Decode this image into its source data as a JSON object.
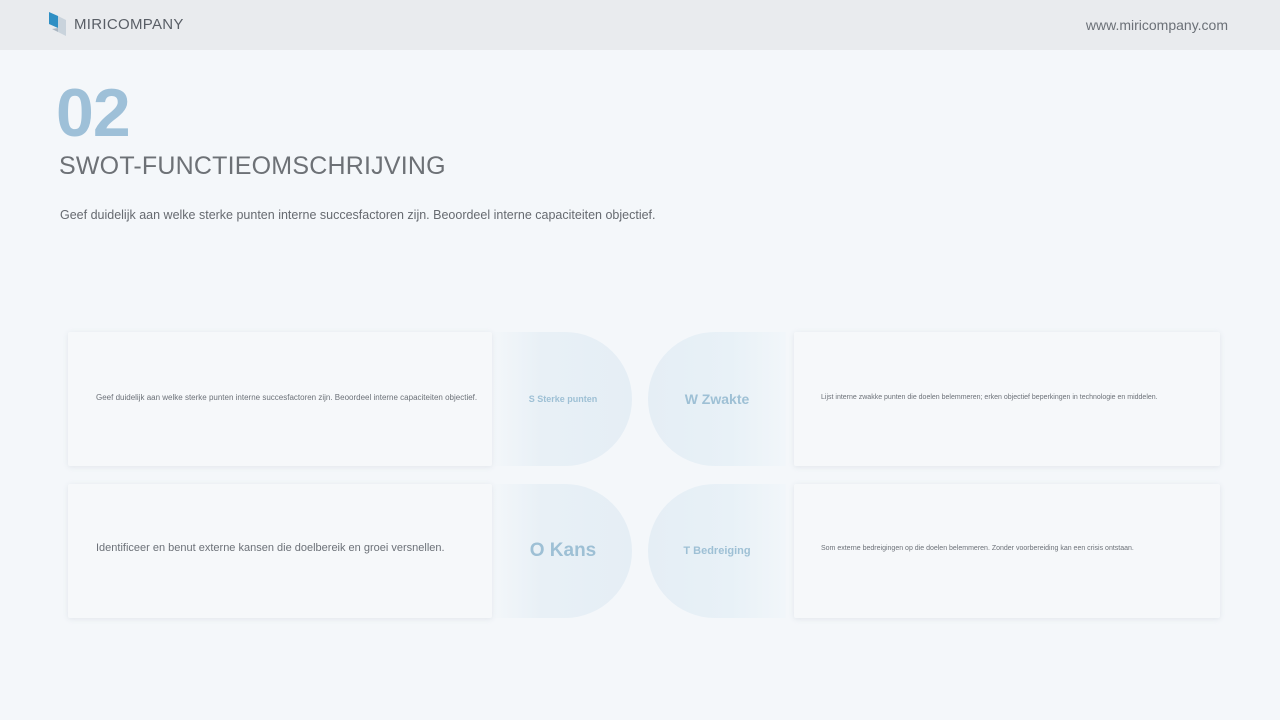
{
  "header": {
    "brand": "MIRICOMPANY",
    "url": "www.miricompany.com",
    "logo_icon": "cube-logo-icon",
    "logo_colors": [
      "#2f8fc4",
      "#c9d3dc"
    ]
  },
  "section": {
    "number": "02",
    "title": "SWOT-FUNCTIEOMSCHRIJVING",
    "subtitle": "Geef duidelijk aan welke sterke punten interne succesfactoren zijn. Beoordeel interne capaciteiten objectief."
  },
  "swot": {
    "strengths": {
      "label": "S Sterke punten",
      "text": "Geef duidelijk aan welke sterke punten interne succesfactoren zijn. Beoordeel interne capaciteiten objectief."
    },
    "weaknesses": {
      "label": "W Zwakte",
      "text": "Lijst interne zwakke punten die doelen belemmeren; erken objectief beperkingen in technologie en middelen."
    },
    "opportunities": {
      "label": "O Kans",
      "text": "Identificeer en benut externe kansen die doelbereik en groei versnellen."
    },
    "threats": {
      "label": "T Bedreiging",
      "text": "Som externe bedreigingen op die doelen belemmeren. Zonder voorbereiding kan een crisis ontstaan."
    }
  },
  "colors": {
    "accent": "#9ec0d8",
    "background": "#f4f7fa",
    "header_bg": "#e9ebee"
  }
}
